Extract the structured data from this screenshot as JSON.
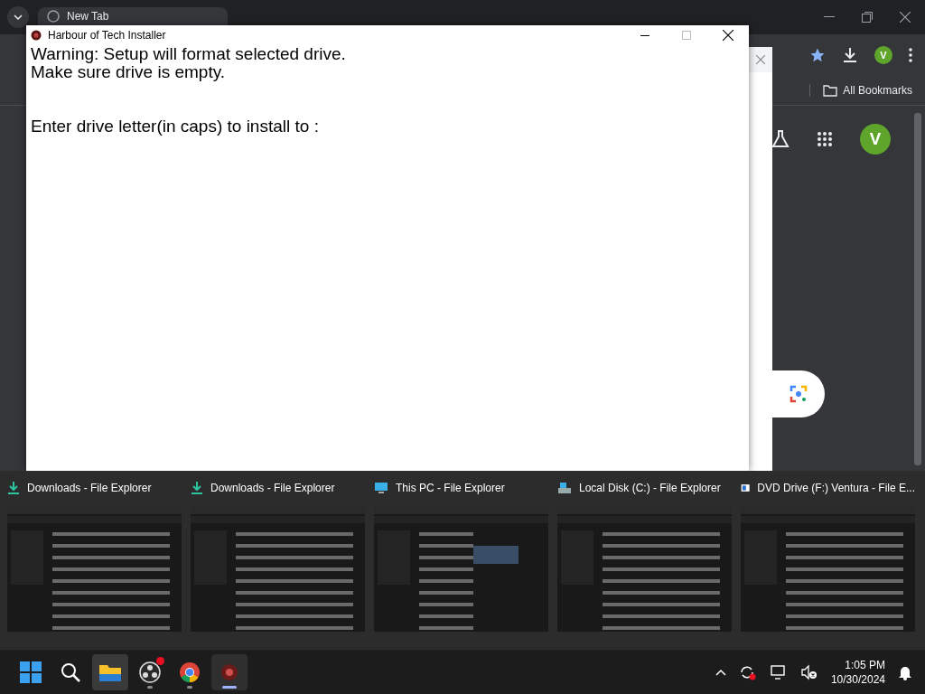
{
  "browser": {
    "tab": {
      "title": "New Tab",
      "selected": true
    },
    "toolbar_profile": {
      "initial": "V"
    },
    "bookmarks_bar": {
      "label": "All Bookmarks"
    },
    "page_profile": {
      "initial": "V"
    }
  },
  "installer": {
    "title": "Harbour of Tech Installer",
    "message": [
      "Warning: Setup will format selected drive.",
      "Make sure drive is empty."
    ],
    "prompt": "Enter drive letter(in caps) to install to :"
  },
  "task_previews": [
    {
      "title": "Downloads - File Explorer",
      "kind": "download"
    },
    {
      "title": "Downloads - File Explorer",
      "kind": "download"
    },
    {
      "title": "This PC - File Explorer",
      "kind": "pc"
    },
    {
      "title": "Local Disk (C:) - File Explorer",
      "kind": "disk"
    },
    {
      "title": "DVD Drive (F:) Ventura - File E...",
      "kind": "dvd"
    }
  ],
  "taskbar": {
    "apps": [
      {
        "kind": "start",
        "open": false,
        "active": false,
        "badge": false
      },
      {
        "kind": "search",
        "open": false,
        "active": false,
        "badge": false
      },
      {
        "kind": "explorer",
        "open": false,
        "active": false,
        "badge": false,
        "hovered": true
      },
      {
        "kind": "obs",
        "open": true,
        "active": false,
        "badge": true
      },
      {
        "kind": "chrome",
        "open": true,
        "active": false,
        "badge": false
      },
      {
        "kind": "installer",
        "open": true,
        "active": true,
        "badge": false
      }
    ],
    "tray": {
      "time": "1:05 PM",
      "date": "10/30/2024"
    }
  }
}
